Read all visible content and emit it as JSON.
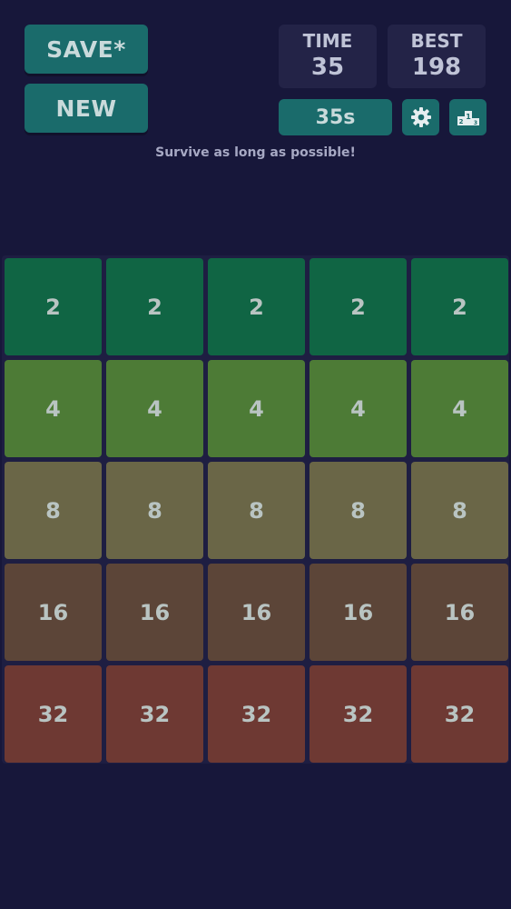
{
  "header": {
    "save_label": "SAVE*",
    "new_label": "NEW",
    "time_label": "TIME",
    "time_value": "35",
    "best_label": "BEST",
    "best_value": "198",
    "timer_label": "35s",
    "settings_icon": "gear-icon",
    "leaderboard_icon": "podium-icon"
  },
  "subtitle": "Survive as long as possible!",
  "board": {
    "rows": [
      [
        "2",
        "2",
        "2",
        "2",
        "2"
      ],
      [
        "4",
        "4",
        "4",
        "4",
        "4"
      ],
      [
        "8",
        "8",
        "8",
        "8",
        "8"
      ],
      [
        "16",
        "16",
        "16",
        "16",
        "16"
      ],
      [
        "32",
        "32",
        "32",
        "32",
        "32"
      ]
    ],
    "tile_colors": {
      "2": "#106544",
      "4": "#4d7b36",
      "8": "#6a6647",
      "16": "#5c4538",
      "32": "#6e3933"
    }
  }
}
